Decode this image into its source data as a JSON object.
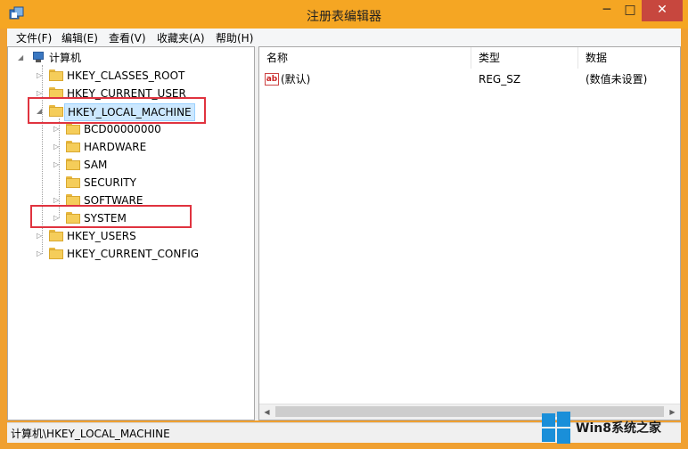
{
  "window": {
    "title": "注册表编辑器"
  },
  "menu": [
    "文件(F)",
    "编辑(E)",
    "查看(V)",
    "收藏夹(A)",
    "帮助(H)"
  ],
  "tree": {
    "root": "计算机",
    "items": [
      "HKEY_CLASSES_ROOT",
      "HKEY_CURRENT_USER",
      "HKEY_LOCAL_MACHINE",
      "BCD00000000",
      "HARDWARE",
      "SAM",
      "SECURITY",
      "SOFTWARE",
      "SYSTEM",
      "HKEY_USERS",
      "HKEY_CURRENT_CONFIG"
    ]
  },
  "columns": [
    "名称",
    "类型",
    "数据"
  ],
  "values": [
    {
      "name": "(默认)",
      "type": "REG_SZ",
      "data": "(数值未设置)"
    }
  ],
  "status": {
    "path": "计算机\\HKEY_LOCAL_MACHINE"
  },
  "watermark": {
    "text": "Win8系统之家"
  }
}
